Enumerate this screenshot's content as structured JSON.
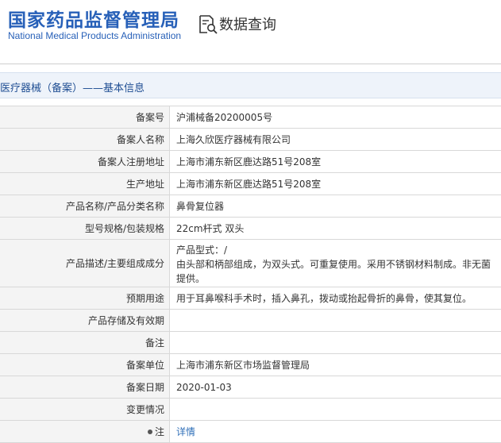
{
  "header": {
    "logo_cn": "国家药品监督管理局",
    "logo_en": "National Medical Products Administration",
    "query_icon": "data-query-icon",
    "query_label": "数据查询"
  },
  "breadcrumb": "医疗器械（备案）——基本信息",
  "colors": {
    "brand": "#2760b8",
    "link": "#2f6fb8",
    "label_bg": "#f4f4f4",
    "crumb_bg": "#eef3fa"
  },
  "rows": [
    {
      "label": "备案号",
      "value": "沪浦械备20200005号"
    },
    {
      "label": "备案人名称",
      "value": "上海久欣医疗器械有限公司"
    },
    {
      "label": "备案人注册地址",
      "value": "上海市浦东新区鹿达路51号208室"
    },
    {
      "label": "生产地址",
      "value": "上海市浦东新区鹿达路51号208室"
    },
    {
      "label": "产品名称/产品分类名称",
      "value": "鼻骨复位器"
    },
    {
      "label": "型号规格/包装规格",
      "value": "22cm杆式 双头"
    },
    {
      "label": "产品描述/主要组成成分",
      "value_line1": "产品型式：/",
      "value_line2": "由头部和柄部组成，为双头式。可重复使用。采用不锈钢材料制成。非无菌提供。"
    },
    {
      "label": "预期用途",
      "value": "用于耳鼻喉科手术时，插入鼻孔，拨动或抬起骨折的鼻骨，使其复位。"
    },
    {
      "label": "产品存储及有效期",
      "value": ""
    },
    {
      "label": "备注",
      "value": ""
    },
    {
      "label": "备案单位",
      "value": "上海市浦东新区市场监督管理局"
    },
    {
      "label": "备案日期",
      "value": "2020-01-03"
    },
    {
      "label": "变更情况",
      "value": ""
    },
    {
      "label": "注",
      "value": "详情"
    }
  ]
}
